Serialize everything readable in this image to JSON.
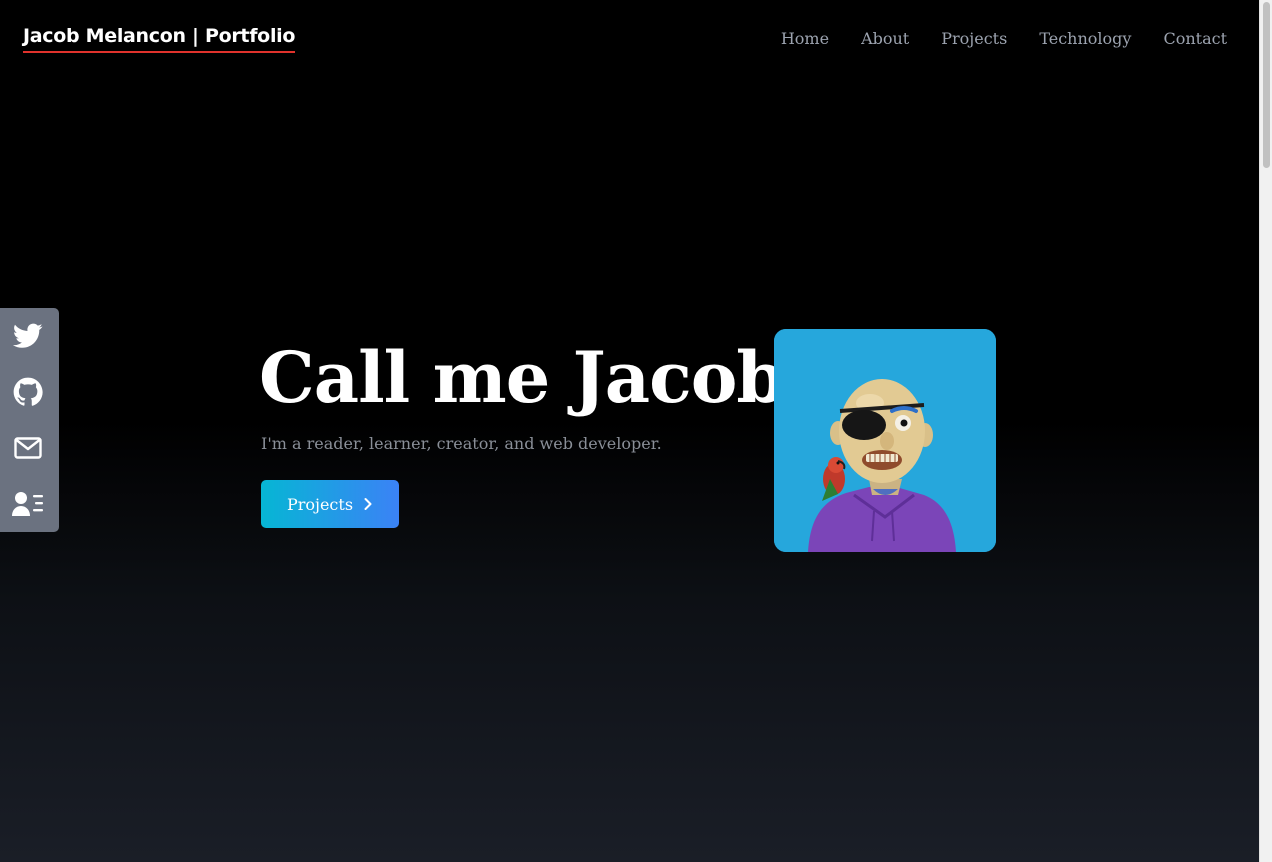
{
  "header": {
    "brand": "Jacob Melancon | Portfolio",
    "nav": [
      "Home",
      "About",
      "Projects",
      "Technology",
      "Contact"
    ]
  },
  "social": {
    "items": [
      {
        "icon": "twitter-icon"
      },
      {
        "icon": "github-icon"
      },
      {
        "icon": "mail-icon"
      },
      {
        "icon": "contact-card-icon"
      }
    ]
  },
  "hero": {
    "title": "Call me Jacob",
    "subtitle": "I'm a reader, learner, creator, and web developer.",
    "cta_label": "Projects",
    "cta_icon": "chevron-right-icon"
  },
  "colors": {
    "accent_underline": "#e0322c",
    "cta_gradient_start": "#06b6d4",
    "cta_gradient_end": "#3b82f6",
    "avatar_background": "#26a7dc"
  }
}
